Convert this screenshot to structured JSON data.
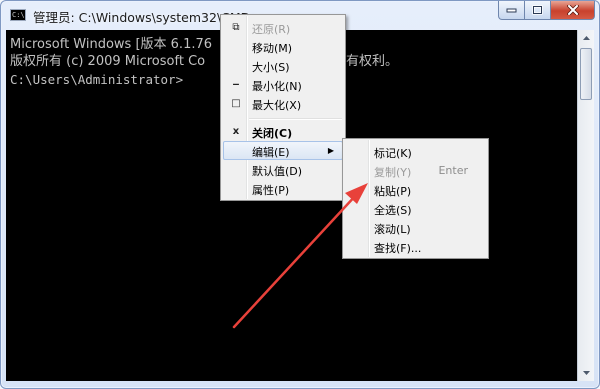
{
  "window": {
    "title": "管理员: C:\\Windows\\system32\\CMD.exe",
    "icon_text": "C:\\"
  },
  "console": {
    "lines": [
      "Microsoft Windows [版本 6.1.76",
      "版权所有 (c) 2009 Microsoft Co",
      "C:\\Users\\Administrator>"
    ],
    "lines_right": [
      "有权利。"
    ]
  },
  "system_menu": {
    "items": [
      {
        "icon": "restore-icon",
        "glyph": "⧉",
        "label": "还原(R)",
        "disabled": true
      },
      {
        "icon": "",
        "glyph": "",
        "label": "移动(M)"
      },
      {
        "icon": "",
        "glyph": "",
        "label": "大小(S)"
      },
      {
        "icon": "minimize-icon",
        "glyph": "‒",
        "label": "最小化(N)"
      },
      {
        "icon": "maximize-icon",
        "glyph": "□",
        "label": "最大化(X)"
      },
      {
        "icon": "close-icon",
        "glyph": "x",
        "label": "关闭(C)",
        "bold": true
      },
      {
        "icon": "",
        "glyph": "",
        "label": "编辑(E)",
        "submenu": true,
        "highlighted": true
      },
      {
        "icon": "",
        "glyph": "",
        "label": "默认值(D)"
      },
      {
        "icon": "",
        "glyph": "",
        "label": "属性(P)"
      }
    ]
  },
  "edit_submenu": {
    "items": [
      {
        "label": "标记(K)"
      },
      {
        "label": "复制(Y)",
        "accelerator": "Enter",
        "disabled": true
      },
      {
        "label": "粘贴(P)"
      },
      {
        "label": "全选(S)"
      },
      {
        "label": "滚动(L)"
      },
      {
        "label": "查找(F)..."
      }
    ]
  },
  "colors": {
    "annotation_arrow": "#e8413a",
    "console_bg": "#000000",
    "console_text": "#c2c2c2"
  }
}
